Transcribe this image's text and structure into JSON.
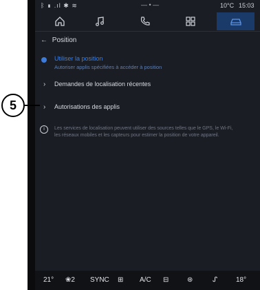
{
  "status": {
    "signal": "ᛒ ▮ .ıl ✱ ≋",
    "center": "— • —",
    "temperature": "10°C",
    "time": "15:03"
  },
  "tabs": [
    {
      "icon": "home-icon"
    },
    {
      "icon": "music-icon"
    },
    {
      "icon": "phone-icon"
    },
    {
      "icon": "apps-icon"
    },
    {
      "icon": "car-icon",
      "active": true
    }
  ],
  "header": {
    "title": "Position"
  },
  "settings": {
    "use_location": {
      "label": "Utiliser la position",
      "sub": "Autoriser applis spécifiées à accéder à position"
    },
    "recent_requests": {
      "label": "Demandes de localisation récentes"
    },
    "app_permissions": {
      "label": "Autorisations des applis"
    },
    "info": {
      "text": "Les services de localisation peuvent utiliser des sources telles que le GPS, le Wi-Fi, les réseaux mobiles et les capteurs pour estimer la position de votre appareil."
    }
  },
  "callout": {
    "number": "5"
  },
  "bottom_bar": {
    "temp_left": "21°",
    "fan": "❀2",
    "sync": "SYNC",
    "defrost_front": "⊞",
    "ac": "A/C",
    "defrost_rear": "⊟",
    "recirc": "⊛",
    "seat": "ᔑ",
    "temp_right": "18°"
  },
  "colors": {
    "accent": "#3a7fe0",
    "tab_active": "#1a3b6a",
    "background": "#1b1d24"
  }
}
